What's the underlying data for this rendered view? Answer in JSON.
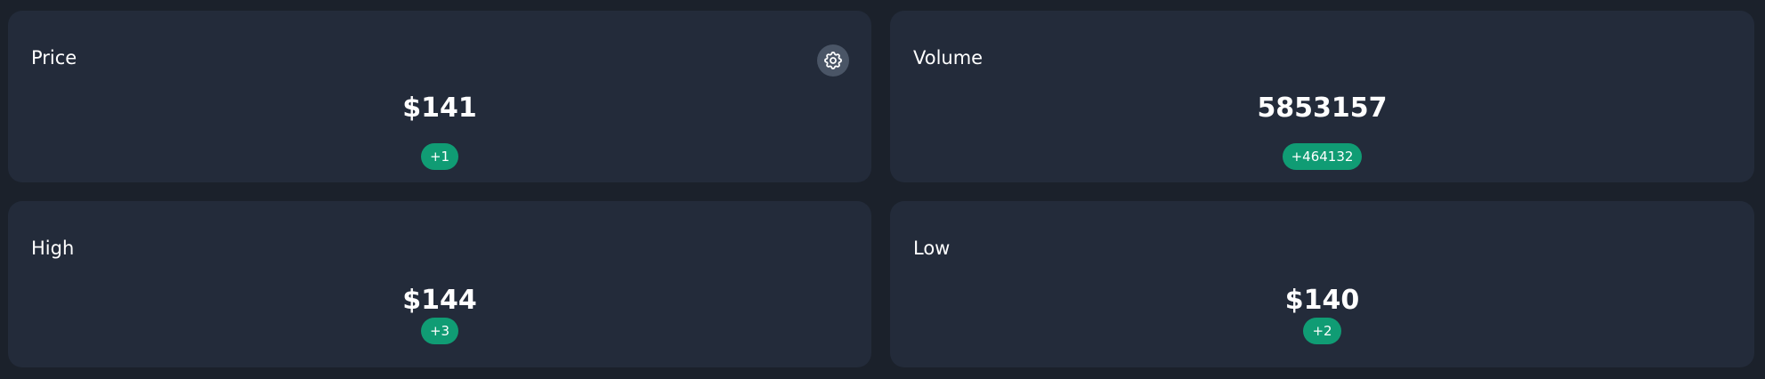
{
  "settings": {
    "icon": "gear-icon"
  },
  "cards": [
    {
      "title": "Price",
      "value": "$141",
      "change": "+1"
    },
    {
      "title": "Volume",
      "value": "5853157",
      "change": "+464132"
    },
    {
      "title": "High",
      "value": "$144",
      "change": "+3"
    },
    {
      "title": "Low",
      "value": "$140",
      "change": "+2"
    }
  ],
  "colors": {
    "page_background": "#1b212b",
    "card_background": "#232b3a",
    "positive_badge": "#109c74",
    "settings_button": "#4a5566",
    "text": "#ffffff"
  }
}
